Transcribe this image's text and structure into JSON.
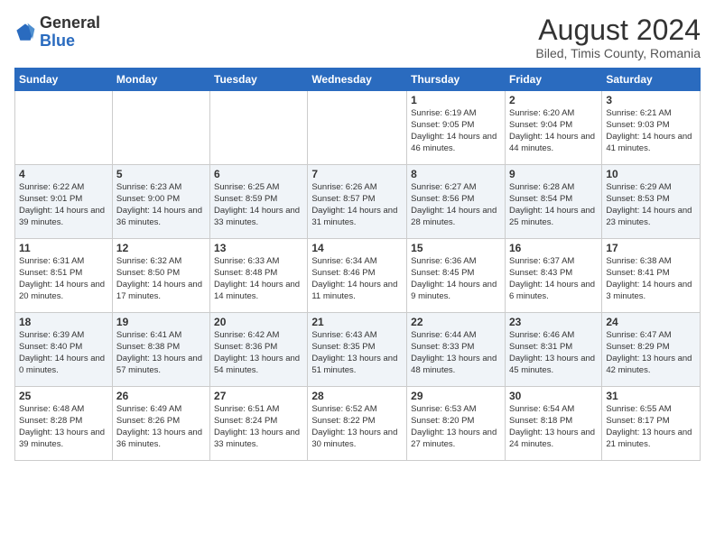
{
  "header": {
    "logo_general": "General",
    "logo_blue": "Blue",
    "month_title": "August 2024",
    "subtitle": "Biled, Timis County, Romania"
  },
  "days_of_week": [
    "Sunday",
    "Monday",
    "Tuesday",
    "Wednesday",
    "Thursday",
    "Friday",
    "Saturday"
  ],
  "weeks": [
    [
      {
        "day": "",
        "info": ""
      },
      {
        "day": "",
        "info": ""
      },
      {
        "day": "",
        "info": ""
      },
      {
        "day": "",
        "info": ""
      },
      {
        "day": "1",
        "info": "Sunrise: 6:19 AM\nSunset: 9:05 PM\nDaylight: 14 hours and 46 minutes."
      },
      {
        "day": "2",
        "info": "Sunrise: 6:20 AM\nSunset: 9:04 PM\nDaylight: 14 hours and 44 minutes."
      },
      {
        "day": "3",
        "info": "Sunrise: 6:21 AM\nSunset: 9:03 PM\nDaylight: 14 hours and 41 minutes."
      }
    ],
    [
      {
        "day": "4",
        "info": "Sunrise: 6:22 AM\nSunset: 9:01 PM\nDaylight: 14 hours and 39 minutes."
      },
      {
        "day": "5",
        "info": "Sunrise: 6:23 AM\nSunset: 9:00 PM\nDaylight: 14 hours and 36 minutes."
      },
      {
        "day": "6",
        "info": "Sunrise: 6:25 AM\nSunset: 8:59 PM\nDaylight: 14 hours and 33 minutes."
      },
      {
        "day": "7",
        "info": "Sunrise: 6:26 AM\nSunset: 8:57 PM\nDaylight: 14 hours and 31 minutes."
      },
      {
        "day": "8",
        "info": "Sunrise: 6:27 AM\nSunset: 8:56 PM\nDaylight: 14 hours and 28 minutes."
      },
      {
        "day": "9",
        "info": "Sunrise: 6:28 AM\nSunset: 8:54 PM\nDaylight: 14 hours and 25 minutes."
      },
      {
        "day": "10",
        "info": "Sunrise: 6:29 AM\nSunset: 8:53 PM\nDaylight: 14 hours and 23 minutes."
      }
    ],
    [
      {
        "day": "11",
        "info": "Sunrise: 6:31 AM\nSunset: 8:51 PM\nDaylight: 14 hours and 20 minutes."
      },
      {
        "day": "12",
        "info": "Sunrise: 6:32 AM\nSunset: 8:50 PM\nDaylight: 14 hours and 17 minutes."
      },
      {
        "day": "13",
        "info": "Sunrise: 6:33 AM\nSunset: 8:48 PM\nDaylight: 14 hours and 14 minutes."
      },
      {
        "day": "14",
        "info": "Sunrise: 6:34 AM\nSunset: 8:46 PM\nDaylight: 14 hours and 11 minutes."
      },
      {
        "day": "15",
        "info": "Sunrise: 6:36 AM\nSunset: 8:45 PM\nDaylight: 14 hours and 9 minutes."
      },
      {
        "day": "16",
        "info": "Sunrise: 6:37 AM\nSunset: 8:43 PM\nDaylight: 14 hours and 6 minutes."
      },
      {
        "day": "17",
        "info": "Sunrise: 6:38 AM\nSunset: 8:41 PM\nDaylight: 14 hours and 3 minutes."
      }
    ],
    [
      {
        "day": "18",
        "info": "Sunrise: 6:39 AM\nSunset: 8:40 PM\nDaylight: 14 hours and 0 minutes."
      },
      {
        "day": "19",
        "info": "Sunrise: 6:41 AM\nSunset: 8:38 PM\nDaylight: 13 hours and 57 minutes."
      },
      {
        "day": "20",
        "info": "Sunrise: 6:42 AM\nSunset: 8:36 PM\nDaylight: 13 hours and 54 minutes."
      },
      {
        "day": "21",
        "info": "Sunrise: 6:43 AM\nSunset: 8:35 PM\nDaylight: 13 hours and 51 minutes."
      },
      {
        "day": "22",
        "info": "Sunrise: 6:44 AM\nSunset: 8:33 PM\nDaylight: 13 hours and 48 minutes."
      },
      {
        "day": "23",
        "info": "Sunrise: 6:46 AM\nSunset: 8:31 PM\nDaylight: 13 hours and 45 minutes."
      },
      {
        "day": "24",
        "info": "Sunrise: 6:47 AM\nSunset: 8:29 PM\nDaylight: 13 hours and 42 minutes."
      }
    ],
    [
      {
        "day": "25",
        "info": "Sunrise: 6:48 AM\nSunset: 8:28 PM\nDaylight: 13 hours and 39 minutes."
      },
      {
        "day": "26",
        "info": "Sunrise: 6:49 AM\nSunset: 8:26 PM\nDaylight: 13 hours and 36 minutes."
      },
      {
        "day": "27",
        "info": "Sunrise: 6:51 AM\nSunset: 8:24 PM\nDaylight: 13 hours and 33 minutes."
      },
      {
        "day": "28",
        "info": "Sunrise: 6:52 AM\nSunset: 8:22 PM\nDaylight: 13 hours and 30 minutes."
      },
      {
        "day": "29",
        "info": "Sunrise: 6:53 AM\nSunset: 8:20 PM\nDaylight: 13 hours and 27 minutes."
      },
      {
        "day": "30",
        "info": "Sunrise: 6:54 AM\nSunset: 8:18 PM\nDaylight: 13 hours and 24 minutes."
      },
      {
        "day": "31",
        "info": "Sunrise: 6:55 AM\nSunset: 8:17 PM\nDaylight: 13 hours and 21 minutes."
      }
    ]
  ]
}
